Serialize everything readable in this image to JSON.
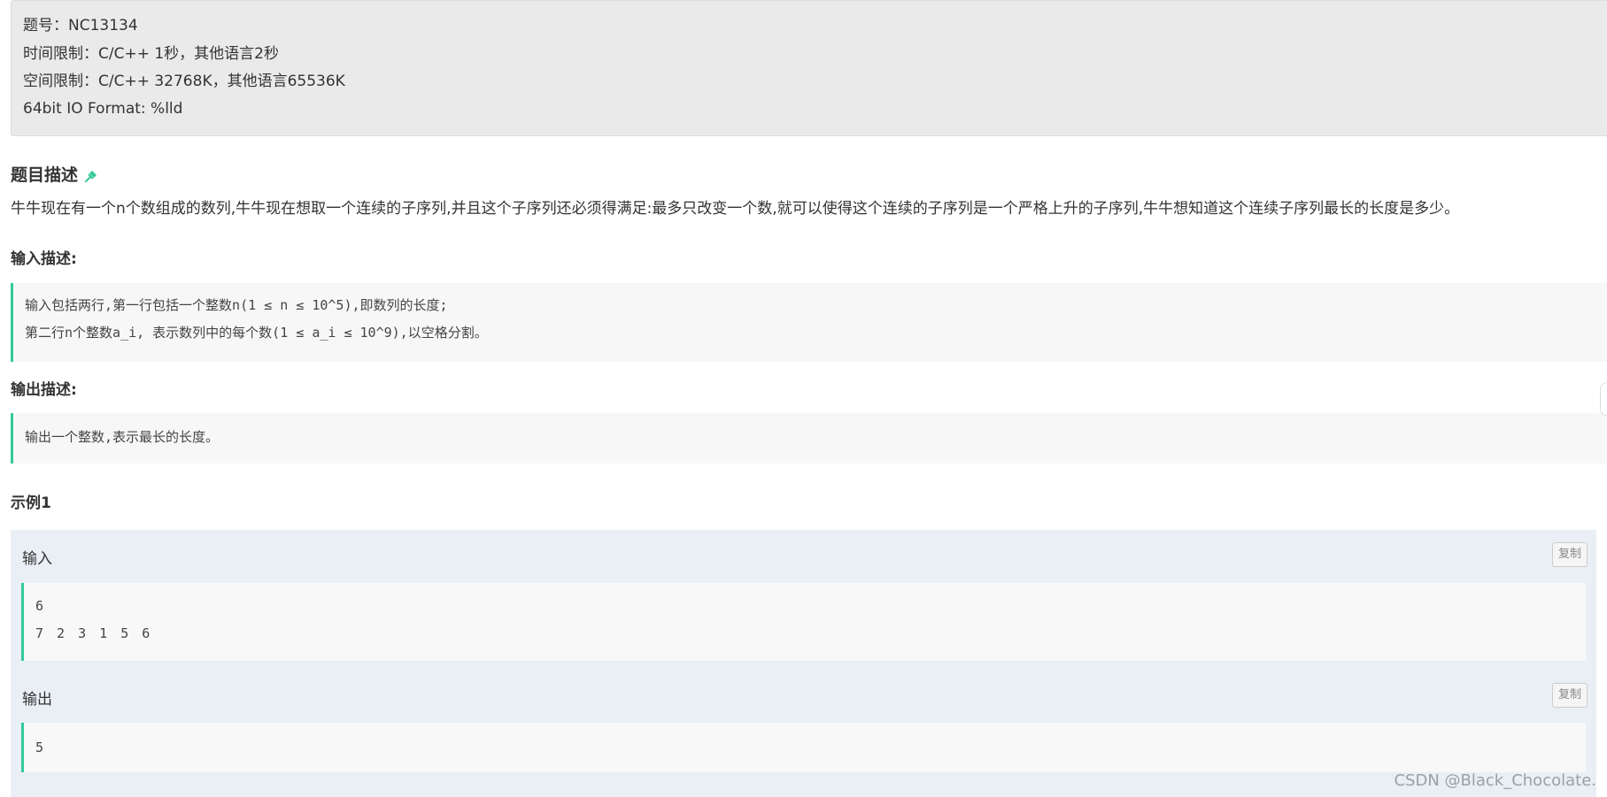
{
  "problem_info": {
    "id_line": "题号：NC13134",
    "time_limit": "时间限制：C/C++ 1秒，其他语言2秒",
    "space_limit": "空间限制：C/C++ 32768K，其他语言65536K",
    "io_format": "64bit IO Format: %lld"
  },
  "description": {
    "title": "题目描述",
    "pin_icon": "pin-icon",
    "text": "牛牛现在有一个n个数组成的数列,牛牛现在想取一个连续的子序列,并且这个子序列还必须得满足:最多只改变一个数,就可以使得这个连续的子序列是一个严格上升的子序列,牛牛想知道这个连续子序列最长的长度是多少。"
  },
  "input_desc": {
    "title": "输入描述:",
    "lines": [
      "输入包括两行,第一行包括一个整数n(1 ≤ n ≤ 10^5),即数列的长度;",
      "第二行n个整数a_i, 表示数列中的每个数(1 ≤ a_i ≤ 10^9),以空格分割。"
    ]
  },
  "output_desc": {
    "title": "输出描述:",
    "lines": [
      "输出一个整数,表示最长的长度。"
    ]
  },
  "example": {
    "title": "示例1",
    "input_label": "输入",
    "input_lines": [
      "6",
      "7 2 3 1 5 6"
    ],
    "output_label": "输出",
    "output_lines": [
      "5"
    ],
    "copy_label": "复制"
  },
  "watermark": "CSDN @Black_Chocolate.",
  "colors": {
    "accent": "#32ca99",
    "info_bg": "#eaeaea",
    "example_bg": "#e9eff5"
  }
}
